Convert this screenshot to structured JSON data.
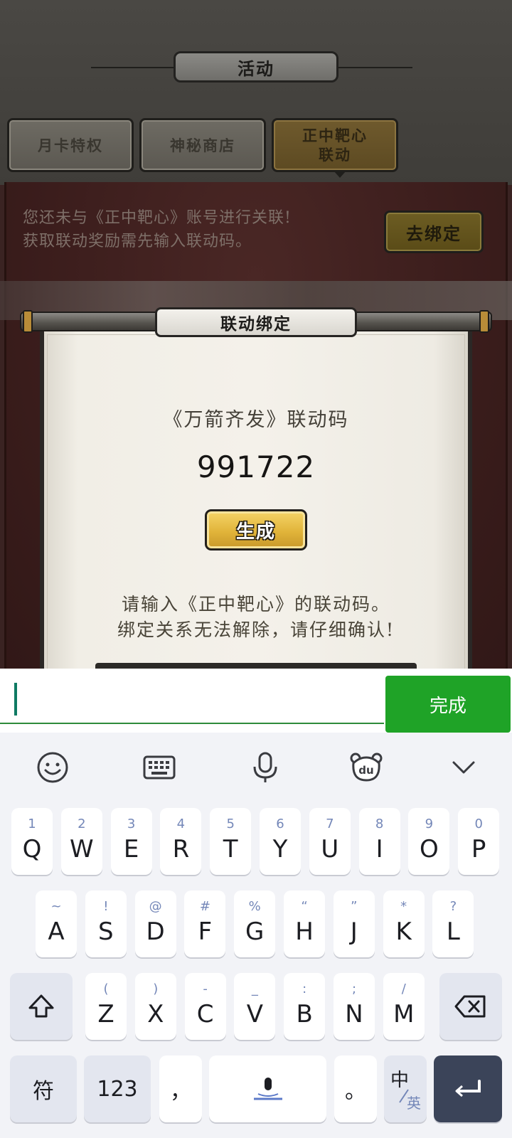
{
  "game": {
    "header_title": "活动",
    "tabs": [
      {
        "label": "月卡特权",
        "active": false
      },
      {
        "label": "神秘商店",
        "active": false
      },
      {
        "label": "正中靶心\n联动",
        "active": true
      }
    ],
    "notice_lines": [
      "您还未与《正中靶心》账号进行关联!",
      "获取联动奖励需先输入联动码。"
    ],
    "bind_button": "去绑定",
    "dialog": {
      "title": "联动绑定",
      "code_label": "《万箭齐发》联动码",
      "code_value": "991722",
      "generate_button": "生成",
      "instruction_lines": [
        "请输入《正中靶心》的联动码。",
        "绑定关系无法解除，请仔细确认!"
      ]
    }
  },
  "input_bar": {
    "value": "",
    "done_label": "完成",
    "accent_color": "#1fa327"
  },
  "keyboard": {
    "toolbar_icons": [
      "emoji-icon",
      "keyboard-icon",
      "microphone-icon",
      "baidu-du-icon",
      "collapse-chevron-icon"
    ],
    "row1": [
      {
        "main": "Q",
        "hint": "1"
      },
      {
        "main": "W",
        "hint": "2"
      },
      {
        "main": "E",
        "hint": "3"
      },
      {
        "main": "R",
        "hint": "4"
      },
      {
        "main": "T",
        "hint": "5"
      },
      {
        "main": "Y",
        "hint": "6"
      },
      {
        "main": "U",
        "hint": "7"
      },
      {
        "main": "I",
        "hint": "8"
      },
      {
        "main": "O",
        "hint": "9"
      },
      {
        "main": "P",
        "hint": "0"
      }
    ],
    "row2": [
      {
        "main": "A",
        "hint": "~"
      },
      {
        "main": "S",
        "hint": "!"
      },
      {
        "main": "D",
        "hint": "@"
      },
      {
        "main": "F",
        "hint": "#"
      },
      {
        "main": "G",
        "hint": "%"
      },
      {
        "main": "H",
        "hint": "“"
      },
      {
        "main": "J",
        "hint": "”"
      },
      {
        "main": "K",
        "hint": "*"
      },
      {
        "main": "L",
        "hint": "?"
      }
    ],
    "row3": [
      {
        "main": "Z",
        "hint": "("
      },
      {
        "main": "X",
        "hint": ")"
      },
      {
        "main": "C",
        "hint": "-"
      },
      {
        "main": "V",
        "hint": "_"
      },
      {
        "main": "B",
        "hint": ":"
      },
      {
        "main": "N",
        "hint": ";"
      },
      {
        "main": "M",
        "hint": "/"
      }
    ],
    "symbol_key": "符",
    "numeric_key": "123",
    "comma_key": "，",
    "period_key": "。",
    "lang_key_top": "中",
    "lang_key_bottom": "英",
    "enter_color": "#3b4459"
  }
}
